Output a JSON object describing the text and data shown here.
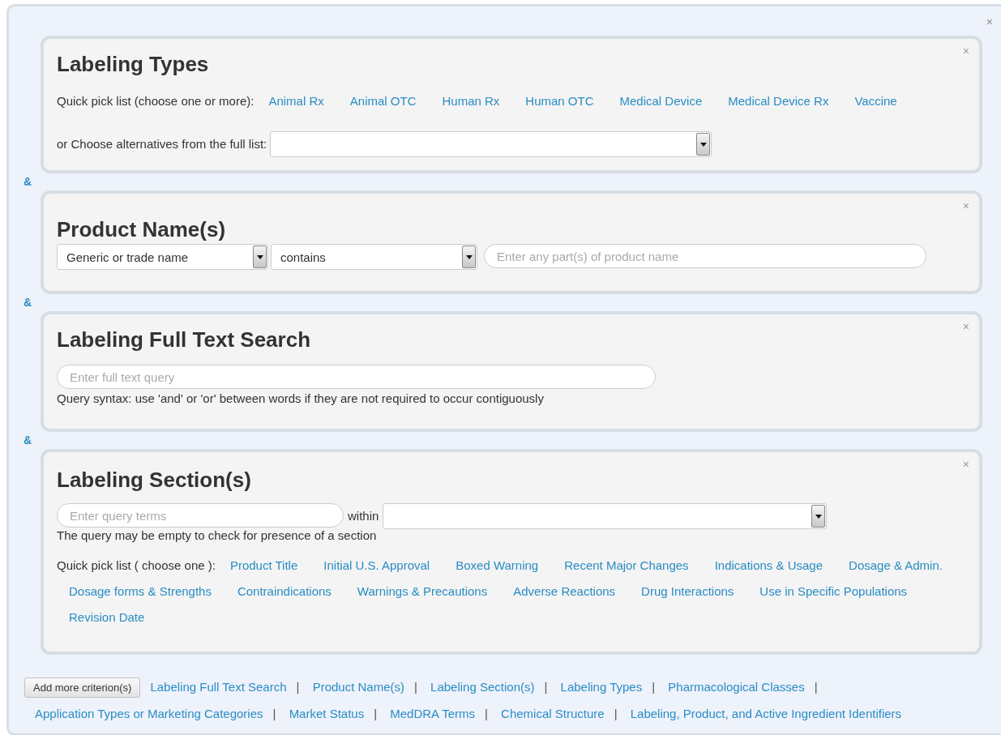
{
  "close": "×",
  "criteria": [
    {
      "kind": "types",
      "title": "Labeling Types",
      "close": "×",
      "quick_pick_label": "Quick pick list (choose one or more):",
      "quick_picks": [
        "Animal Rx",
        "Animal OTC",
        "Human Rx",
        "Human OTC",
        "Medical Device",
        "Medical Device Rx",
        "Vaccine"
      ],
      "full_list_label": "or Choose alternatives from the full list:"
    },
    {
      "kind": "product",
      "joiner": "&",
      "title": "Product Name(s)",
      "close": "×",
      "field_select": "Generic or trade name",
      "operator_select": "contains",
      "placeholder": "Enter any part(s) of product name"
    },
    {
      "kind": "fulltext",
      "joiner": "&",
      "title": "Labeling Full Text Search",
      "close": "×",
      "placeholder": "Enter full text query",
      "hint": "Query syntax: use 'and' or 'or' between words if they are not required to occur contiguously"
    },
    {
      "kind": "sections",
      "joiner": "&",
      "title": "Labeling Section(s)",
      "close": "×",
      "placeholder": "Enter query terms",
      "within_label": "within",
      "note": "The query may be empty to check for presence of a section",
      "quick_pick_label": "Quick pick list ( choose one ):",
      "quick_picks": [
        "Product Title",
        "Initial U.S. Approval",
        "Boxed Warning",
        "Recent Major Changes",
        "Indications & Usage",
        "Dosage & Admin.",
        "Dosage forms & Strengths",
        "Contraindications",
        "Warnings & Precautions",
        "Adverse Reactions",
        "Drug Interactions",
        "Use in Specific Populations",
        "Revision Date"
      ]
    }
  ],
  "add_button": "Add more criterion(s)",
  "criteria_links": [
    {
      "label": "Labeling Full Text Search",
      "separator": "|"
    },
    {
      "label": "Product Name(s)",
      "separator": "|"
    },
    {
      "label": "Labeling Section(s)",
      "separator": "|"
    },
    {
      "label": "Labeling Types",
      "separator": "|"
    },
    {
      "label": "Pharmacological Classes",
      "separator": "|"
    },
    {
      "label": "Application Types or Marketing Categories",
      "separator": "|"
    },
    {
      "label": "Market Status",
      "separator": "|"
    },
    {
      "label": "MedDRA Terms",
      "separator": "|"
    },
    {
      "label": "Chemical Structure",
      "separator": "|"
    },
    {
      "label": "Labeling, Product, and Active Ingredient Identifiers"
    }
  ]
}
